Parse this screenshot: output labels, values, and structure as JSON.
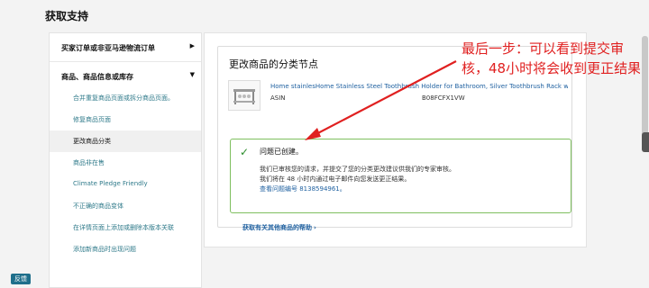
{
  "page": {
    "title": "获取支持"
  },
  "sidebar": {
    "sections": [
      {
        "label": "买家订单或非亚马逊物流订单",
        "expanded": false
      },
      {
        "label": "商品、商品信息或库存",
        "expanded": true
      }
    ],
    "items": [
      {
        "label": "合并重复商品页面或拆分商品页面。",
        "active": false
      },
      {
        "label": "修复商品页面",
        "active": false
      },
      {
        "label": "更改商品分类",
        "active": true
      },
      {
        "label": "商品非在售",
        "active": false
      },
      {
        "label": "Climate Pledge Friendly",
        "active": false
      },
      {
        "label": "不正确的商品变体",
        "active": false
      },
      {
        "label": "在详情页面上添加或删除本版本关联",
        "active": false
      },
      {
        "label": "添加新商品时出现问题",
        "active": false
      }
    ]
  },
  "main": {
    "card_title": "更改商品的分类节点",
    "product": {
      "name": "Home stainlesHome Stainless Steel Toothbrush Holder for Bathroom, Silver Toothbrush Rack with",
      "asin_label": "ASIN",
      "asin_value": "B08FCFX1VW"
    },
    "success": {
      "title": "问题已创建。",
      "line1": "我们已审核您的请求，并提交了您的分类更改建议供我们的专家审核。",
      "line2": "我们将在 48 小时内通过电子邮件向您发送更正结果。",
      "line3": "查看问题编号 8138594961。"
    },
    "more_help": "获取有关其他商品的帮助",
    "more_help_chevron": "›"
  },
  "annotation": {
    "text": "最后一步：可以看到提交审核，48小时将会收到更正结果",
    "color": "#e02020"
  },
  "feedback": {
    "label": "反馈"
  },
  "colors": {
    "link": "#2162a1",
    "sidebar_link": "#2f7a8a",
    "success_border": "#7fbf5f",
    "check": "#2a8c2a"
  },
  "icons": {
    "collapsed": "triangle-right-icon",
    "expanded": "triangle-down-icon",
    "check": "check-icon"
  }
}
